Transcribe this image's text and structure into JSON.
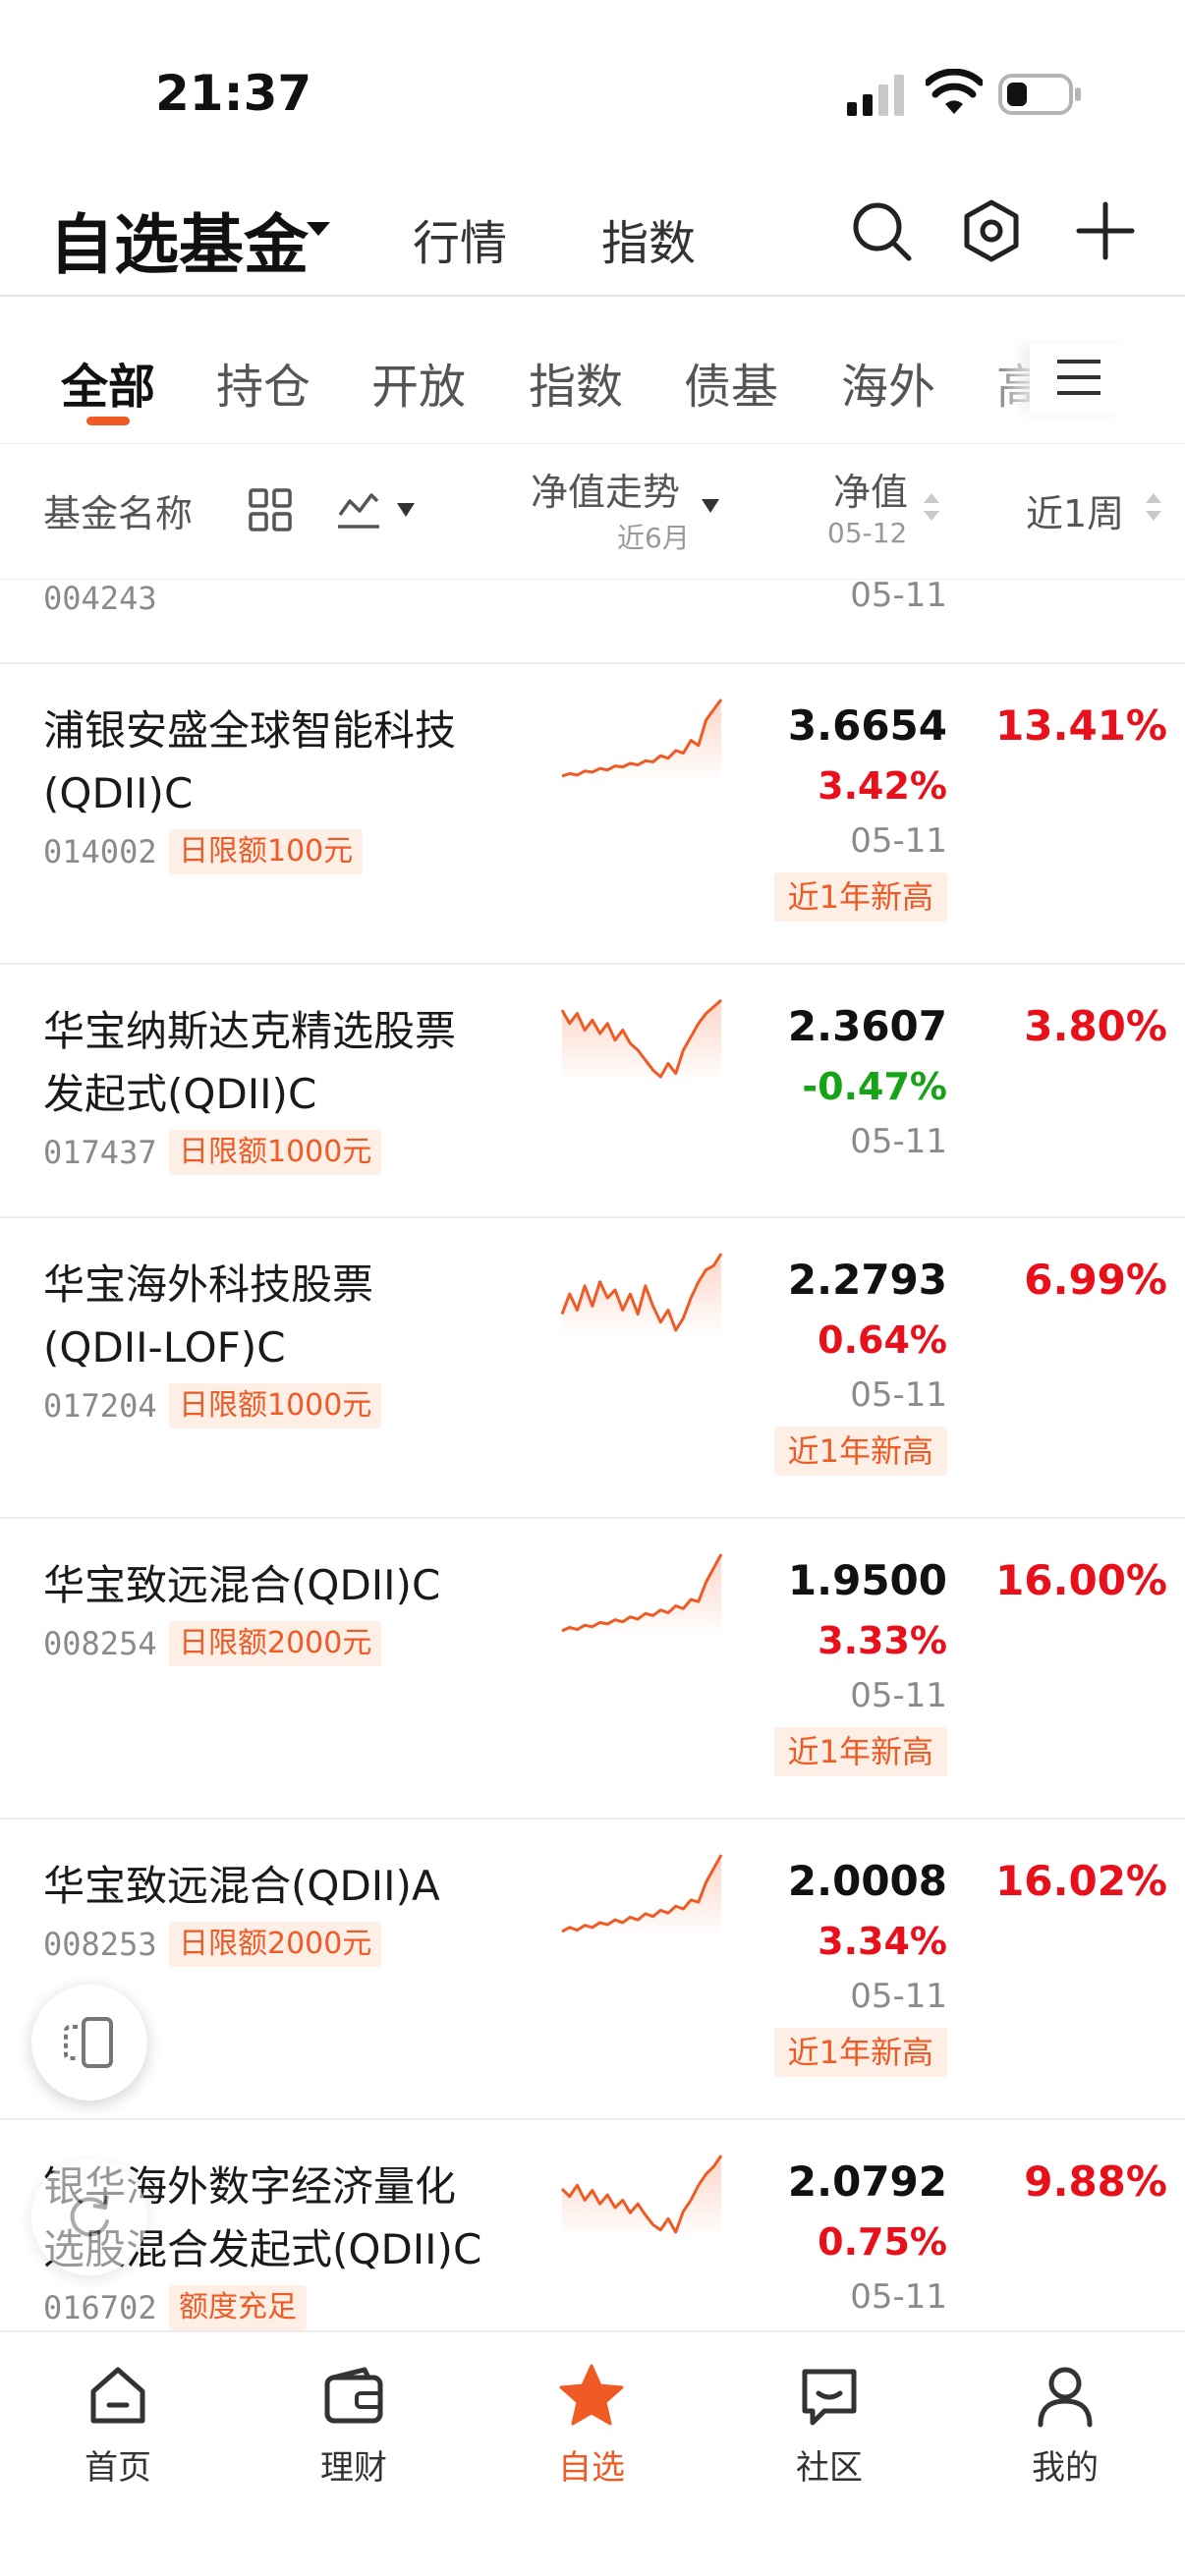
{
  "status_bar": {
    "time": "21:37"
  },
  "header": {
    "title": "自选基金",
    "tabs": [
      "行情",
      "指数"
    ]
  },
  "category_tabs": [
    "全部",
    "持仓",
    "开放",
    "指数",
    "债基",
    "海外",
    "高"
  ],
  "columns": {
    "name": "基金名称",
    "trend": "净值走势",
    "trend_sub": "近6月",
    "nav": "净值",
    "nav_sub": "05-12",
    "week": "近1周"
  },
  "partial_row": {
    "code": "004243",
    "date": "05-11"
  },
  "funds": [
    {
      "name_line1": "浦银安盛全球智能科技",
      "name_line2": "(QDII)C",
      "code": "014002",
      "limit": "日限额100元",
      "nav": "3.6654",
      "change": "3.42%",
      "change_dir": "up",
      "date": "05-11",
      "badge": "近1年新高",
      "week": "13.41%",
      "trend": [
        1.5,
        1.55,
        1.52,
        1.6,
        1.58,
        1.65,
        1.62,
        1.7,
        1.68,
        1.75,
        1.72,
        1.8,
        1.78,
        1.9,
        1.85,
        2.0,
        1.95,
        2.2,
        2.1,
        2.6,
        2.8,
        3.0
      ]
    },
    {
      "name_line1": "华宝纳斯达克精选股票",
      "name_line2": "发起式(QDII)C",
      "code": "017437",
      "limit": "日限额1000元",
      "nav": "2.3607",
      "change": "-0.47%",
      "change_dir": "down",
      "date": "05-11",
      "badge": "",
      "week": "3.80%",
      "trend": [
        2.5,
        2.3,
        2.45,
        2.2,
        2.35,
        2.15,
        2.3,
        2.05,
        2.2,
        2.0,
        1.9,
        1.75,
        1.6,
        1.5,
        1.7,
        1.55,
        1.9,
        2.1,
        2.3,
        2.45,
        2.55,
        2.65
      ]
    },
    {
      "name_line1": "华宝海外科技股票",
      "name_line2": "(QDII-LOF)C",
      "code": "017204",
      "limit": "日限额1000元",
      "nav": "2.2793",
      "change": "0.64%",
      "change_dir": "up",
      "date": "05-11",
      "badge": "近1年新高",
      "week": "6.99%",
      "trend": [
        2.0,
        2.25,
        2.05,
        2.35,
        2.1,
        2.4,
        2.2,
        2.3,
        2.05,
        2.25,
        2.0,
        2.35,
        2.1,
        1.9,
        2.05,
        1.8,
        1.95,
        2.2,
        2.4,
        2.55,
        2.6,
        2.75
      ]
    },
    {
      "name_line1": "华宝致远混合(QDII)C",
      "name_line2": "",
      "code": "008254",
      "limit": "日限额2000元",
      "nav": "1.9500",
      "change": "3.33%",
      "change_dir": "up",
      "date": "05-11",
      "badge": "近1年新高",
      "week": "16.00%",
      "trend": [
        1.5,
        1.55,
        1.52,
        1.58,
        1.56,
        1.62,
        1.6,
        1.66,
        1.63,
        1.7,
        1.67,
        1.75,
        1.72,
        1.8,
        1.76,
        1.86,
        1.82,
        1.95,
        1.92,
        2.2,
        2.4,
        2.6
      ]
    },
    {
      "name_line1": "华宝致远混合(QDII)A",
      "name_line2": "",
      "code": "008253",
      "limit": "日限额2000元",
      "nav": "2.0008",
      "change": "3.34%",
      "change_dir": "up",
      "date": "05-11",
      "badge": "近1年新高",
      "week": "16.02%",
      "trend": [
        1.5,
        1.56,
        1.52,
        1.59,
        1.56,
        1.63,
        1.6,
        1.67,
        1.63,
        1.71,
        1.67,
        1.76,
        1.72,
        1.81,
        1.77,
        1.87,
        1.83,
        1.96,
        1.93,
        2.22,
        2.42,
        2.62
      ]
    },
    {
      "name_line1": "银华海外数字经济量化",
      "name_line2": "选股混合发起式(QDII)C",
      "code": "016702",
      "limit": "额度充足",
      "nav": "2.0792",
      "change": "0.75%",
      "change_dir": "up",
      "date": "05-11",
      "badge": "",
      "week": "9.88%",
      "trend": [
        2.2,
        2.1,
        2.25,
        2.05,
        2.18,
        2.0,
        2.12,
        1.95,
        2.05,
        1.88,
        2.0,
        1.85,
        1.72,
        1.65,
        1.8,
        1.62,
        1.9,
        2.05,
        2.25,
        2.4,
        2.5,
        2.65
      ]
    }
  ],
  "bottom_nav": [
    {
      "label": "首页",
      "icon": "home-icon"
    },
    {
      "label": "理财",
      "icon": "wallet-icon"
    },
    {
      "label": "自选",
      "icon": "star-icon"
    },
    {
      "label": "社区",
      "icon": "chat-icon"
    },
    {
      "label": "我的",
      "icon": "user-icon"
    }
  ],
  "colors": {
    "accent": "#f05a24",
    "up": "#e8101a",
    "down": "#17a317"
  }
}
